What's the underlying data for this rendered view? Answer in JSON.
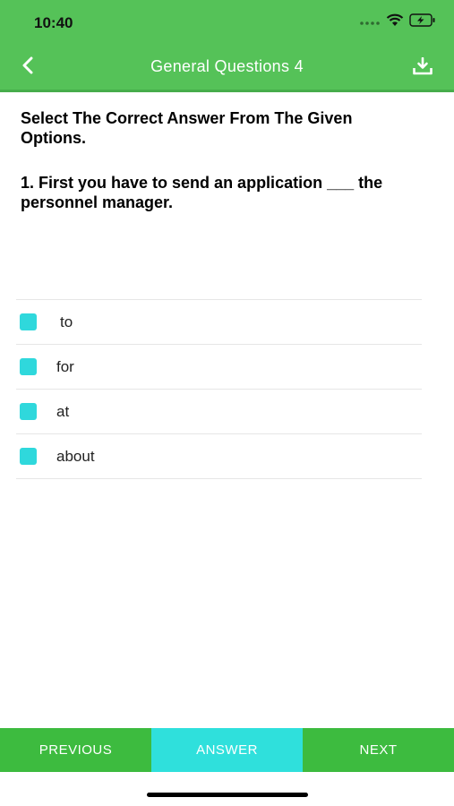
{
  "status_bar": {
    "time": "10:40",
    "icons": [
      "signal-dots-icon",
      "wifi-icon",
      "battery-charging-icon"
    ]
  },
  "nav": {
    "title": "General Questions 4",
    "back_icon": "chevron-left-icon",
    "download_icon": "download-icon"
  },
  "instruction": "Select The Correct Answer From The Given Options.",
  "question": "1. First you have to send an application ___ the personnel manager.",
  "options": [
    {
      "label": "to"
    },
    {
      "label": "for"
    },
    {
      "label": "at"
    },
    {
      "label": "about"
    }
  ],
  "bottom_bar": {
    "previous_label": "PREVIOUS",
    "answer_label": "ANSWER",
    "next_label": "NEXT"
  },
  "colors": {
    "header_green": "#55c258",
    "button_green": "#3dbb3f",
    "accent_cyan": "#2fe0dc"
  }
}
